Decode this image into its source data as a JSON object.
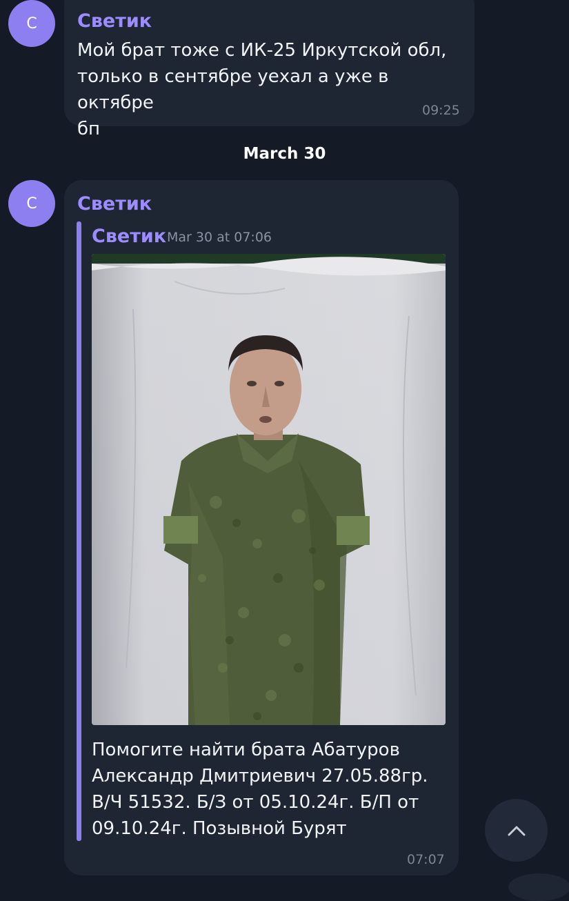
{
  "messages": [
    {
      "avatar_letter": "С",
      "sender": "Светик",
      "text": "Мой брат тоже с ИК-25 Иркутской обл,\nтолько в сентябре уехал а уже в октябре\nбп",
      "time": "09:25"
    },
    {
      "avatar_letter": "С",
      "sender": "Светик",
      "forwarded": {
        "sender": "Светик",
        "datetime": "Mar 30 at 07:06",
        "photo": {
          "icon": "photo-of-man-in-camouflage"
        },
        "caption": "Помогите найти брата Абатуров\nАлександр Дмитриевич 27.05.88гр.\nВ/Ч 51532. Б/З от 05.10.24г. Б/П от\n09.10.24г. Позывной Бурят"
      },
      "time": "07:07"
    }
  ],
  "date_separator": "March 30",
  "scroll_button": {
    "icon": "chevron-up-icon"
  },
  "colors": {
    "background": "#141a26",
    "bubble": "#1e2533",
    "accent": "#8e7ff0",
    "sender_name": "#9d8cff"
  }
}
